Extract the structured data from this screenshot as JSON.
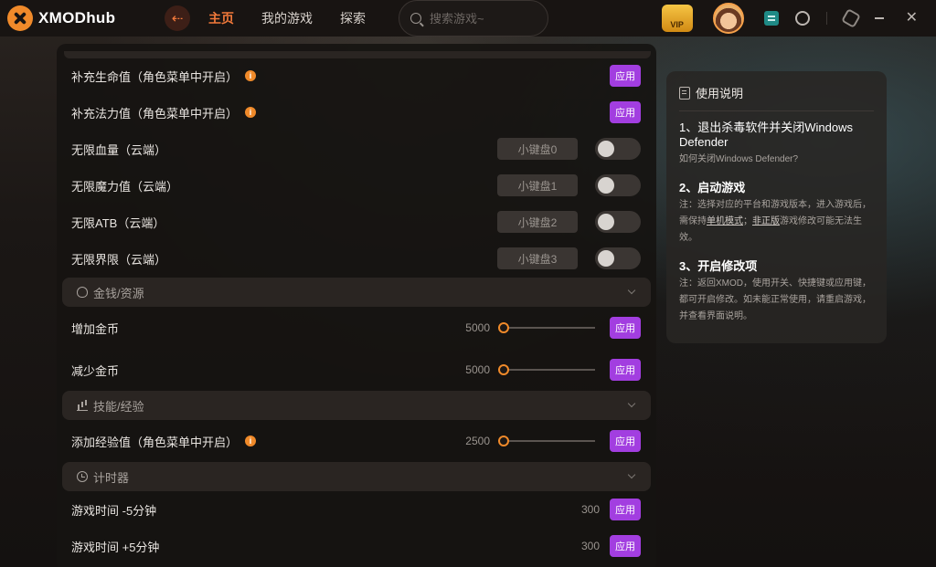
{
  "app": {
    "name": "XMODhub"
  },
  "nav": {
    "home": "主页",
    "my_games": "我的游戏",
    "explore": "探索"
  },
  "search": {
    "placeholder": "搜索游戏~"
  },
  "header": {
    "vip_label": "VIP"
  },
  "panel": {
    "rows_top": [
      {
        "label": "补充生命值（角色菜单中开启）",
        "info": "i",
        "button": "应用"
      },
      {
        "label": "补充法力值（角色菜单中开启）",
        "info": "i",
        "button": "应用"
      }
    ],
    "toggle_rows": [
      {
        "label": "无限血量（云端）",
        "key": "小键盘0",
        "on": false
      },
      {
        "label": "无限魔力值（云端）",
        "key": "小键盘1",
        "on": false
      },
      {
        "label": "无限ATB（云端）",
        "key": "小键盘2",
        "on": false
      },
      {
        "label": "无限界限（云端）",
        "key": "小键盘3",
        "on": false
      }
    ],
    "sections": {
      "money": "金钱/资源",
      "skills": "技能/经验",
      "timer": "计时器"
    },
    "money_rows": [
      {
        "label": "增加金币",
        "value": "5000",
        "button": "应用"
      },
      {
        "label": "减少金币",
        "value": "5000",
        "button": "应用"
      }
    ],
    "skill_rows": [
      {
        "label": "添加经验值（角色菜单中开启）",
        "info": "i",
        "value": "2500",
        "button": "应用"
      }
    ],
    "timer_rows": [
      {
        "label": "游戏时间 -5分钟",
        "value": "300",
        "button": "应用"
      },
      {
        "label": "游戏时间 +5分钟",
        "value": "300",
        "button": "应用"
      }
    ]
  },
  "guide": {
    "title": "使用说明",
    "step1": {
      "num": "1、",
      "title": "退出杀毒软件并关闭Windows Defender",
      "note": "如何关闭Windows Defender?"
    },
    "step2": {
      "num": "2、",
      "title": "启动游戏",
      "note_a": "注：选择对应的平台和游戏版本，进入游戏后，需保持",
      "note_link1": "单机模式",
      "note_b": "；",
      "note_link2": "非正版",
      "note_c": "游戏修改可能无法生效。"
    },
    "step3": {
      "num": "3、",
      "title": "开启修改项",
      "note": "注：返回XMOD，使用开关、快捷键或应用键，都可开启修改。如未能正常使用，请重启游戏，并查看界面说明。"
    }
  }
}
